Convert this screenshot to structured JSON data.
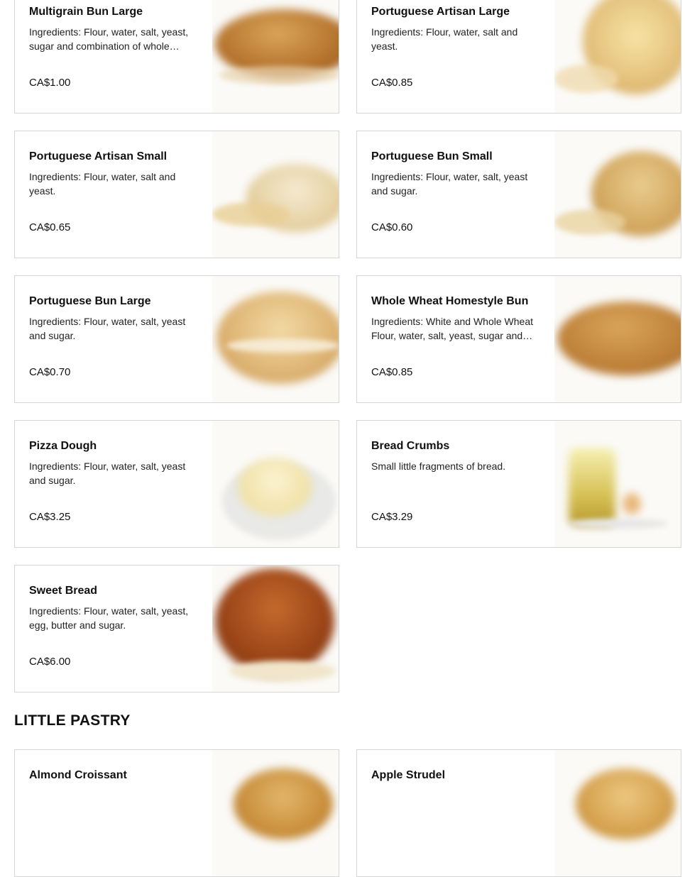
{
  "products": [
    {
      "name": "Multigrain Bun Large",
      "desc": "Ingredients: Flour, water, salt, yeast, sugar and combination of whole…",
      "price": "CA$1.00"
    },
    {
      "name": "Portuguese Artisan Large",
      "desc": "Ingredients: Flour, water, salt and yeast.",
      "price": "CA$0.85"
    },
    {
      "name": "Portuguese Artisan Small",
      "desc": "Ingredients: Flour, water, salt and yeast.",
      "price": "CA$0.65"
    },
    {
      "name": "Portuguese Bun Small",
      "desc": "Ingredients: Flour, water, salt, yeast and sugar.",
      "price": "CA$0.60"
    },
    {
      "name": "Portuguese Bun Large",
      "desc": "Ingredients: Flour, water, salt, yeast and sugar.",
      "price": "CA$0.70"
    },
    {
      "name": "Whole Wheat Homestyle Bun",
      "desc": "Ingredients: White and Whole Wheat Flour, water, salt, yeast, sugar and…",
      "price": "CA$0.85"
    },
    {
      "name": "Pizza Dough",
      "desc": "Ingredients: Flour, water, salt, yeast and sugar.",
      "price": "CA$3.25"
    },
    {
      "name": "Bread Crumbs",
      "desc": "Small little fragments of bread.",
      "price": "CA$3.29"
    },
    {
      "name": "Sweet Bread",
      "desc": "Ingredients: Flour, water, salt, yeast, egg, butter and sugar.",
      "price": "CA$6.00"
    }
  ],
  "section": {
    "title": "LITTLE PASTRY"
  },
  "pastry": [
    {
      "name": "Almond Croissant"
    },
    {
      "name": "Apple Strudel"
    }
  ]
}
